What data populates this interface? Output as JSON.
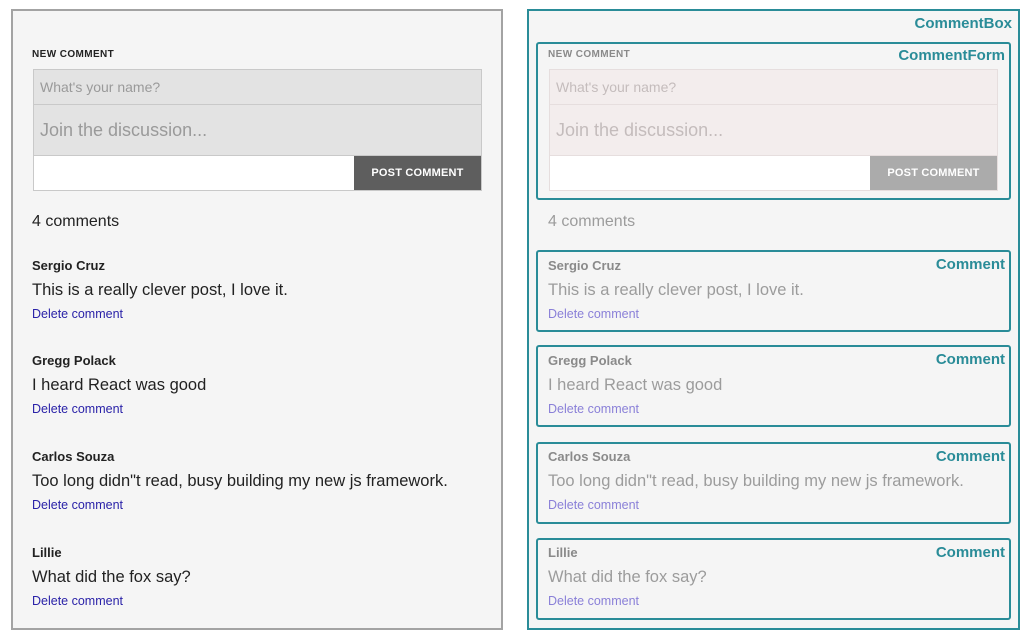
{
  "form": {
    "section_label": "NEW COMMENT",
    "name_placeholder": "What's your name?",
    "text_placeholder": "Join the discussion...",
    "submit_label": "POST COMMENT"
  },
  "comments_count": "4 comments",
  "comments": [
    {
      "author": "Sergio Cruz",
      "body": "This is a really clever post, I love it.",
      "delete_label": "Delete comment"
    },
    {
      "author": "Gregg Polack",
      "body": "I heard React was good",
      "delete_label": "Delete comment"
    },
    {
      "author": "Carlos Souza",
      "body": "Too long didn\"t read, busy building my new js framework.",
      "delete_label": "Delete comment"
    },
    {
      "author": "Lillie",
      "body": "What did the fox say?",
      "delete_label": "Delete comment"
    }
  ],
  "annotations": {
    "comment_box": "CommentBox",
    "comment_form": "CommentForm",
    "comment": "Comment"
  },
  "colors": {
    "component_outline": "#2a8c98",
    "link": "#2a22a8",
    "button": "#5e5e5e"
  }
}
